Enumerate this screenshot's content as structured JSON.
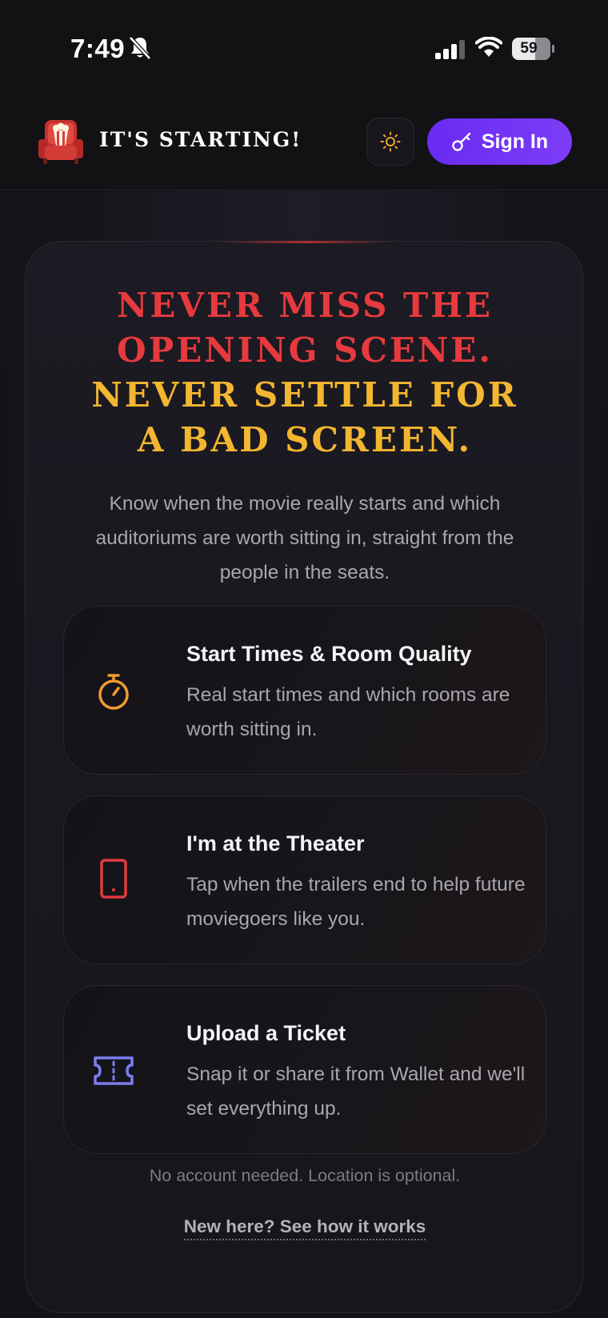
{
  "status_bar": {
    "time": "7:49",
    "battery": "59"
  },
  "header": {
    "brand": "IT'S STARTING!",
    "signin_label": "Sign In",
    "accent_color": "#6a2bf2"
  },
  "hero": {
    "headline_line1": "NEVER MISS THE",
    "headline_line2": "OPENING SCENE.",
    "headline_line3": "NEVER SETTLE FOR",
    "headline_line4": "A BAD SCREEN.",
    "headline_red": "#e63a3e",
    "headline_gold": "#f3b631",
    "subtitle": "Know when the movie really starts and which auditoriums are worth sitting in, straight from the people in the seats.",
    "features": [
      {
        "icon": "stopwatch-icon",
        "title": "Start Times & Room Quality",
        "description": "Real start times and which rooms are worth sitting in."
      },
      {
        "icon": "phone-icon",
        "title": "I'm at the Theater",
        "description": "Tap when the trailers end to help future moviegoers like you."
      },
      {
        "icon": "ticket-icon",
        "title": "Upload a Ticket",
        "description": "Snap it or share it from Wallet and we'll set everything up."
      }
    ],
    "note": "No account needed. Location is optional.",
    "how_link": "New here? See how it works"
  }
}
